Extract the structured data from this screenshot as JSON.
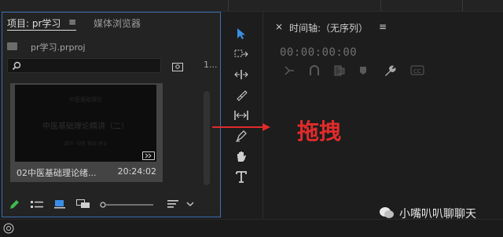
{
  "project_panel": {
    "tab_active": "项目: pr学习",
    "tab_menu": "≡",
    "tab_media_browser": "媒体浏览器",
    "project_file": "pr学习.prproj",
    "search_placeholder": "",
    "item_count": "1...",
    "clip": {
      "name": "02中医基础理论绪...",
      "duration": "20:24:02",
      "thumb_title": "中医基础理论精讲（二）",
      "thumb_top": "中医基础理论",
      "thumb_sub": "讲师 ·中医 基础 理论"
    }
  },
  "timeline": {
    "close": "×",
    "tab": "时间轴:（无序列）",
    "menu": "≡",
    "timecode": "00:00:00:00"
  },
  "annotation": {
    "drag_label": "拖拽"
  },
  "watermark": {
    "text": "小嘴叭叭聊聊天"
  },
  "colors": {
    "accent_blue": "#3a6fb3",
    "annotation_red": "#e02b2b"
  }
}
